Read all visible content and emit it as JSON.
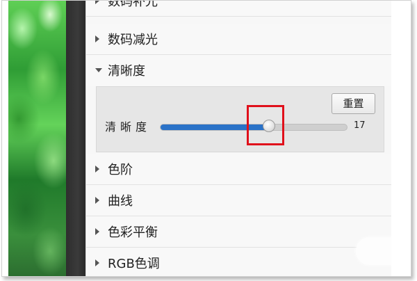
{
  "panel": {
    "sections": [
      {
        "label": "数码补光",
        "expanded": false
      },
      {
        "label": "数码减光",
        "expanded": false
      },
      {
        "label": "清晰度",
        "expanded": true
      },
      {
        "label": "色阶",
        "expanded": false
      },
      {
        "label": "曲线",
        "expanded": false
      },
      {
        "label": "色彩平衡",
        "expanded": false
      },
      {
        "label": "RGB色调",
        "expanded": false
      }
    ],
    "sharpness": {
      "reset_label": "重置",
      "slider_label": "清晰度",
      "value": "17",
      "slider_fraction": 0.58
    }
  },
  "colors": {
    "slider_fill": "#2a72c8",
    "highlight": "#e0101b"
  }
}
